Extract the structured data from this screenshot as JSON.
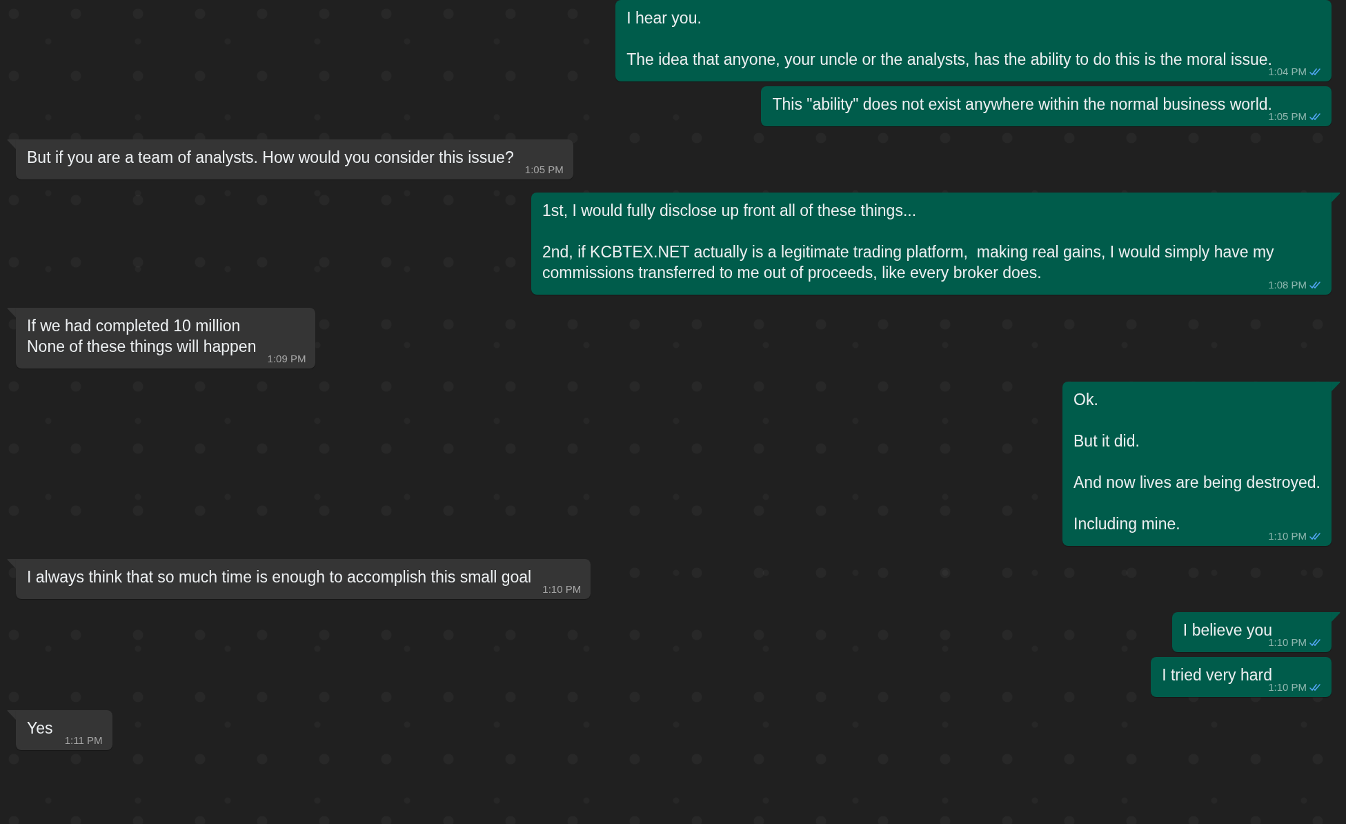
{
  "messages": [
    {
      "outgoing": true,
      "tail": false,
      "read": true,
      "text": "I hear you.\n\nThe idea that anyone, your uncle or the analysts, has the ability to do this is the moral issue.",
      "time": "1:04 PM"
    },
    {
      "outgoing": true,
      "tail": false,
      "read": true,
      "text": "This \"ability\" does not exist anywhere within the normal business world.",
      "time": "1:05 PM"
    },
    {
      "outgoing": false,
      "tail": true,
      "text": "But if you are a team of analysts. How would you consider this issue?",
      "time": "1:05 PM"
    },
    {
      "outgoing": true,
      "tail": true,
      "read": true,
      "text": "1st, I would fully disclose up front all of these things...\n\n2nd, if KCBTEX.NET actually is a legitimate trading platform,  making real gains, I would simply have my commissions transferred to me out of proceeds, like every broker does.",
      "time": "1:08 PM"
    },
    {
      "outgoing": false,
      "tail": true,
      "text": "If we had completed 10 million\nNone of these things will happen",
      "time": "1:09 PM"
    },
    {
      "outgoing": true,
      "tail": true,
      "read": true,
      "text": "Ok.\n\nBut it did.\n\nAnd now lives are being destroyed.\n\nIncluding mine.",
      "time": "1:10 PM"
    },
    {
      "outgoing": false,
      "tail": true,
      "text": "I always think that so much time is enough to accomplish this small goal",
      "time": "1:10 PM"
    },
    {
      "outgoing": true,
      "tail": true,
      "read": true,
      "text": "I believe you",
      "time": "1:10 PM"
    },
    {
      "outgoing": true,
      "tail": false,
      "read": true,
      "text": "I tried very hard",
      "time": "1:10 PM"
    },
    {
      "outgoing": false,
      "tail": true,
      "text": "Yes",
      "time": "1:11 PM"
    }
  ]
}
